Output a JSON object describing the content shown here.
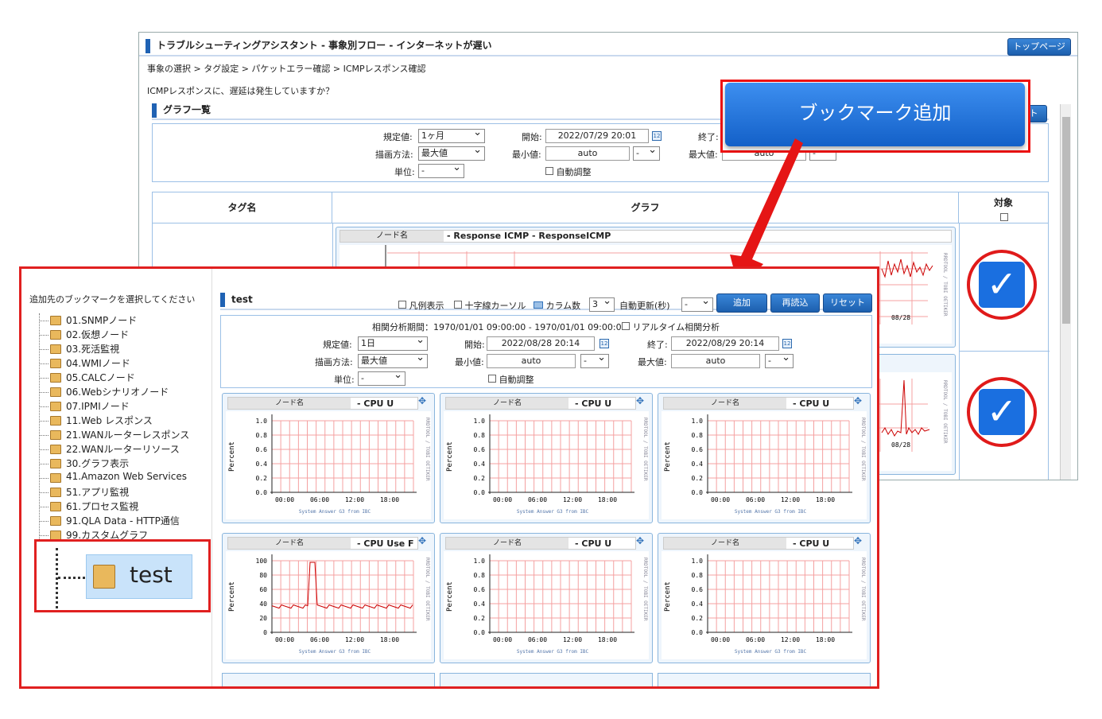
{
  "back": {
    "title": "トラブルシューティングアシスタント - 事象別フロー - インターネットが遅い",
    "top_button": "トップページ",
    "breadcrumb": "事象の選択 > タグ設定 > パケットエラー確認 > ICMPレスポンス確認",
    "question": "ICMPレスポンスに、遅延は発生していますか？",
    "section_title": "グラフ一覧",
    "partial_button": "ト",
    "form": {
      "kitei_label": "規定値:",
      "kitei_value": "1ヶ月",
      "start_label": "開始:",
      "start_value": "2022/07/29 20:01",
      "end_label": "終了:",
      "method_label": "描画方法:",
      "method_value": "最大値",
      "min_label": "最小値:",
      "min_value": "auto",
      "min_sel": "-",
      "max_label": "最大値:",
      "max_value": "auto",
      "max_sel": "-",
      "unit_label": "単位:",
      "unit_value": "-",
      "auto_adjust": "自動調整"
    },
    "table": {
      "col_tag": "タグ名",
      "col_graph": "グラフ",
      "col_target": "対象"
    },
    "graph1": {
      "node": "ノード名",
      "title": "- Response ICMP - ResponseICMP",
      "date": "08/28",
      "side": "RRDTOOL / TOBI OETIKER"
    },
    "graph2": {
      "date": "08/28",
      "side": "RRDTOOL / TOBI OETIKER"
    },
    "check_mark": "✓"
  },
  "callout": {
    "label": "ブックマーク追加",
    "color": "#1f6fe0",
    "border": "#e01a1a"
  },
  "front": {
    "prompt": "追加先のブックマークを選択してください",
    "tree": [
      "01.SNMPノード",
      "02.仮想ノード",
      "03.死活監視",
      "04.WMIノード",
      "05.CALCノード",
      "06.Webシナリオノード",
      "07.IPMIノード",
      "11.Web レスポンス",
      "21.WANルーターレスポンス",
      "22.WANルーターリソース",
      "30.グラフ表示",
      "41.Amazon Web Services",
      "51.アプリ監視",
      "61.プロセス監視",
      "91.QLA Data - HTTP通信",
      "99.カスタムグラフ"
    ],
    "selected": "test",
    "panel_title": "test",
    "toolbar": {
      "legend": "凡例表示",
      "crosshair": "十字線カーソル",
      "columns_label": "カラム数",
      "columns_value": "3",
      "refresh_label": "自動更新(秒)",
      "refresh_value": "-",
      "add": "追加",
      "reload": "再読込",
      "reset": "リセット"
    },
    "form": {
      "period": "相関分析期間：1970/01/01 09:00:00 - 1970/01/01 09:00:00",
      "realtime": "リアルタイム相関分析",
      "kitei_label": "規定値:",
      "kitei_value": "1日",
      "start_label": "開始:",
      "start_value": "2022/08/28 20:14",
      "end_label": "終了:",
      "end_value": "2022/08/29 20:14",
      "method_label": "描画方法:",
      "method_value": "最大値",
      "min_label": "最小値:",
      "min_value": "auto",
      "min_sel": "-",
      "max_label": "最大値:",
      "max_value": "auto",
      "max_sel": "-",
      "unit_label": "単位:",
      "unit_value": "-",
      "auto_adjust": "自動調整"
    },
    "charts": [
      {
        "node": "ノード名",
        "title": "- CPU U",
        "ylabel": "Percent",
        "ticks": [
          "1.0",
          "0.8",
          "0.6",
          "0.4",
          "0.2",
          "0.0"
        ],
        "xticks": [
          "00:00",
          "06:00",
          "12:00",
          "18:00"
        ],
        "footer": "System Answer G3 from IBC",
        "side": "RRDTOOL / TOBI OETIKER",
        "spike": false
      },
      {
        "node": "ノード名",
        "title": "- CPU U",
        "ylabel": "Percent",
        "ticks": [
          "1.0",
          "0.8",
          "0.6",
          "0.4",
          "0.2",
          "0.0"
        ],
        "xticks": [
          "00:00",
          "06:00",
          "12:00",
          "18:00"
        ],
        "footer": "System Answer G3 from IBC",
        "side": "RRDTOOL / TOBI OETIKER",
        "spike": false
      },
      {
        "node": "ノード名",
        "title": "- CPU U",
        "ylabel": "Percent",
        "ticks": [
          "1.0",
          "0.8",
          "0.6",
          "0.4",
          "0.2",
          "0.0"
        ],
        "xticks": [
          "00:00",
          "06:00",
          "12:00",
          "18:00"
        ],
        "footer": "System Answer G3 from IBC",
        "side": "RRDTOOL / TOBI OETIKER",
        "spike": false
      },
      {
        "node": "ノード名",
        "title": "- CPU Use F",
        "ylabel": "Percent",
        "ticks": [
          "100",
          "80",
          "60",
          "40",
          "20",
          "0"
        ],
        "xticks": [
          "00:00",
          "06:00",
          "12:00",
          "18:00"
        ],
        "footer": "System Answer G3 from IBC",
        "side": "RRDTOOL / TOBI OETIKER",
        "spike": true
      },
      {
        "node": "ノード名",
        "title": "- CPU U",
        "ylabel": "Percent",
        "ticks": [
          "1.0",
          "0.8",
          "0.6",
          "0.4",
          "0.2",
          "0.0"
        ],
        "xticks": [
          "00:00",
          "06:00",
          "12:00",
          "18:00"
        ],
        "footer": "System Answer G3 from IBC",
        "side": "RRDTOOL / TOBI OETIKER",
        "spike": false
      },
      {
        "node": "ノード名",
        "title": "- CPU U",
        "ylabel": "Percent",
        "ticks": [
          "1.0",
          "0.8",
          "0.6",
          "0.4",
          "0.2",
          "0.0"
        ],
        "xticks": [
          "00:00",
          "06:00",
          "12:00",
          "18:00"
        ],
        "footer": "System Answer G3 from IBC",
        "side": "RRDTOOL / TOBI OETIKER",
        "spike": false
      }
    ]
  }
}
